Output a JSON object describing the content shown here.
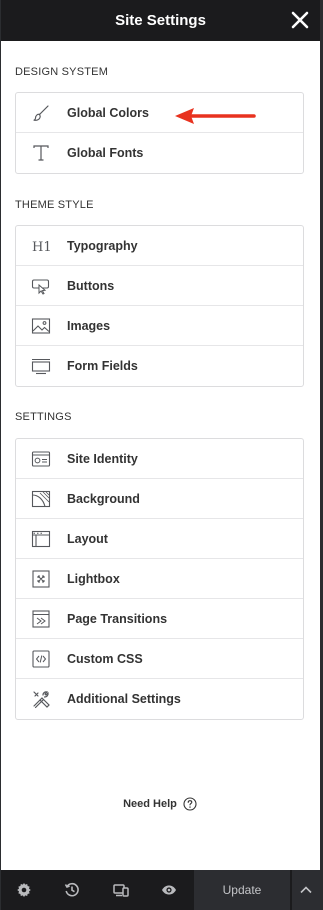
{
  "header": {
    "title": "Site Settings",
    "close_icon": "close-icon"
  },
  "sections": {
    "design_system": {
      "title": "DESIGN SYSTEM",
      "items": [
        {
          "label": "Global Colors",
          "icon": "brush-icon"
        },
        {
          "label": "Global Fonts",
          "icon": "font-t-icon"
        }
      ]
    },
    "theme_style": {
      "title": "THEME STYLE",
      "items": [
        {
          "label": "Typography",
          "icon": "heading-h1-icon"
        },
        {
          "label": "Buttons",
          "icon": "button-pointer-icon"
        },
        {
          "label": "Images",
          "icon": "image-icon"
        },
        {
          "label": "Form Fields",
          "icon": "form-field-icon"
        }
      ]
    },
    "settings": {
      "title": "SETTINGS",
      "items": [
        {
          "label": "Site Identity",
          "icon": "site-identity-icon"
        },
        {
          "label": "Background",
          "icon": "background-icon"
        },
        {
          "label": "Layout",
          "icon": "layout-icon"
        },
        {
          "label": "Lightbox",
          "icon": "lightbox-icon"
        },
        {
          "label": "Page Transitions",
          "icon": "page-transitions-icon"
        },
        {
          "label": "Custom CSS",
          "icon": "code-icon"
        },
        {
          "label": "Additional Settings",
          "icon": "tools-icon"
        }
      ]
    }
  },
  "annotation": {
    "color": "#e8321f"
  },
  "help": {
    "label": "Need Help"
  },
  "footer": {
    "update_label": "Update",
    "icons": [
      "gear-icon",
      "history-icon",
      "responsive-icon",
      "eye-icon",
      "chevron-up-icon"
    ]
  }
}
